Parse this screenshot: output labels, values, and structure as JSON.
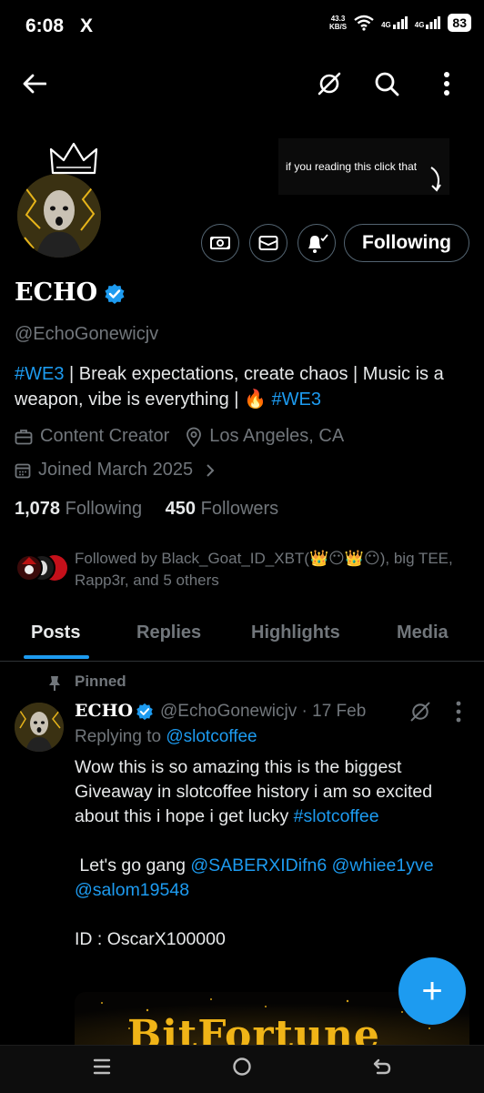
{
  "status_bar": {
    "time": "6:08",
    "x_logo": "X",
    "net_speed_value": "43.3",
    "net_speed_unit": "KB/S",
    "signal1": "4G",
    "signal2": "4G",
    "battery": "83"
  },
  "banner": {
    "text": "if you reading this click that"
  },
  "profile": {
    "name": "ECHO",
    "handle": "@EchoGonewicjv",
    "bio": {
      "tag1": "#WE3",
      "text1": " | Break expectations, create chaos | Music is a weapon, vibe is everything | ",
      "emoji": "🔥",
      "tag2": "#WE3"
    },
    "category": "Content Creator",
    "location": "Los Angeles, CA",
    "joined": "Joined March 2025",
    "following_count": "1,078",
    "following_label": "Following",
    "followers_count": "450",
    "followers_label": "Followers",
    "followed_by": "Followed by Black_Goat_ID_XBT(👑😶👑😶), big TEE, Rapp3r, and 5 others"
  },
  "actions": {
    "following_button": "Following"
  },
  "tabs": [
    "Posts",
    "Replies",
    "Highlights",
    "Media"
  ],
  "post": {
    "pinned_label": "Pinned",
    "author": "ECHO",
    "meta": "@EchoGonewicjv · 17 Feb",
    "replying_label": "Replying to ",
    "replying_handle": "@slotcoffee",
    "body_text": "Wow this is so amazing this is the biggest Giveaway in slotcoffee history i am so excited about this i hope i get lucky ",
    "body_tag": "#slotcoffee",
    "lets_go": "Let's go gang ",
    "mention1": "@SABERXIDifn6",
    "mention2": "@whiee1yve",
    "mention3": "@salom19548",
    "id_line": "ID : OscarX100000",
    "media_title": "BitFortune"
  },
  "fab": {
    "label": "+"
  },
  "colors": {
    "accent": "#1d9bf0",
    "background": "#000000",
    "muted": "#71767b",
    "text": "#e7e9ea"
  },
  "icons": [
    "back-arrow-icon",
    "grok-icon",
    "search-icon",
    "more-vertical-icon",
    "messages-icon",
    "mail-icon",
    "notification-bell-icon",
    "verified-badge-icon",
    "briefcase-icon",
    "location-pin-icon",
    "calendar-icon",
    "chevron-right-icon",
    "pin-icon",
    "plus-icon",
    "menu-icon",
    "home-circle-icon",
    "back-nav-icon"
  ]
}
